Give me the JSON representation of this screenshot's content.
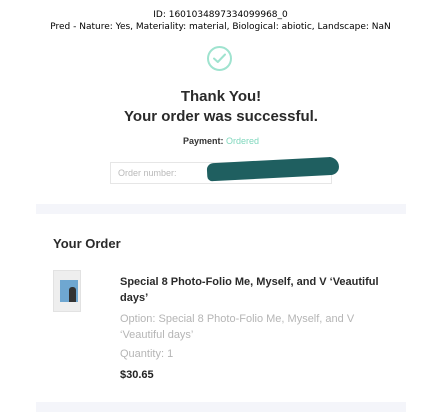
{
  "caption": {
    "line1": "ID: 1601034897334099968_0",
    "line2": "Pred - Nature: Yes, Materiality: material, Biological: abiotic, Landscape: NaN"
  },
  "confirmation": {
    "thanks": "Thank You!",
    "message": "Your order was successful.",
    "payment_label": "Payment:",
    "payment_status": "Ordered",
    "order_number_label": "Order number:"
  },
  "order": {
    "heading": "Your Order",
    "item": {
      "title": "Special 8 Photo-Folio Me, Myself, and V ‘Veautiful days’",
      "option": "Option: Special 8 Photo-Folio Me, Myself, and V ‘Veautiful days’",
      "quantity": "Quantity: 1",
      "price": "$30.65"
    }
  },
  "colors": {
    "accent": "#7fd7bd",
    "redaction": "#1f5f60",
    "band": "#f4f5fa"
  },
  "icons": {
    "success": "check-circle-icon",
    "product": "product-thumbnail"
  }
}
